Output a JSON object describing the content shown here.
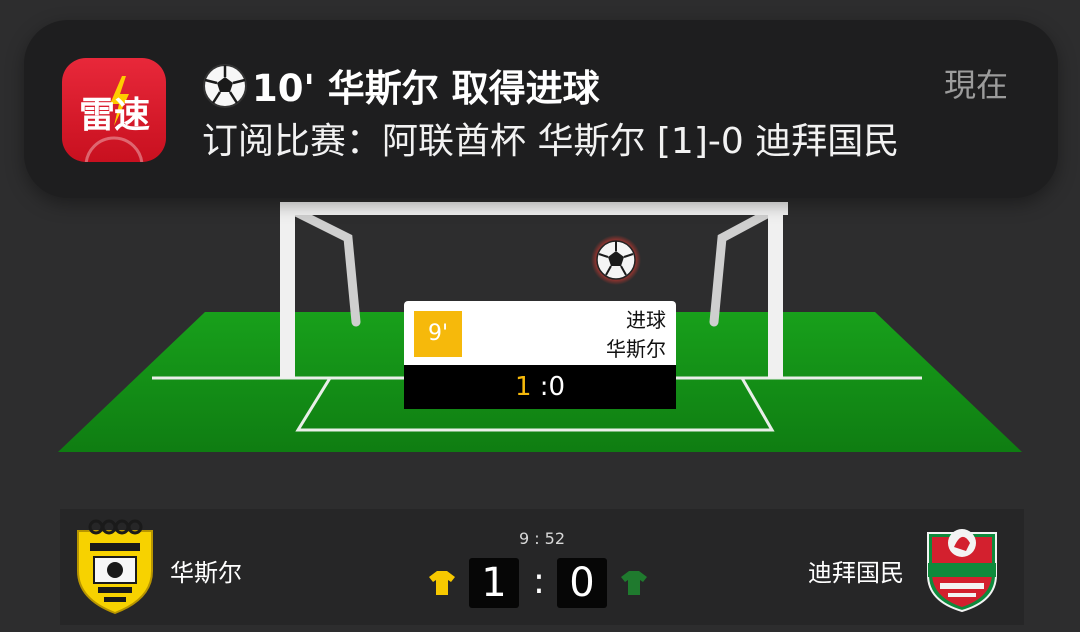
{
  "notification": {
    "app_name": "雷速",
    "title": "10' 华斯尔 取得进球",
    "body": "订阅比赛：阿联酋杯 华斯尔 [1]-0 迪拜国民",
    "time": "現在",
    "icon": "soccer-ball-emoji"
  },
  "event": {
    "minute": "9'",
    "type": "进球",
    "team": "华斯尔",
    "score_home": "1",
    "score_sep": " :",
    "score_away": "0"
  },
  "match": {
    "clock": "9 : 52",
    "home": {
      "name": "华斯尔",
      "score": "1",
      "shirt_color": "#f6c800",
      "crest_colors": [
        "#f7d200",
        "#111111"
      ]
    },
    "away": {
      "name": "迪拜国民",
      "score": "0",
      "shirt_color": "#1f7a2e",
      "crest_colors": [
        "#d3202e",
        "#0e8a3c"
      ]
    },
    "separator": ":"
  },
  "colors": {
    "background": "#2d2d2e",
    "pitch": "#1f9d1f",
    "accent": "#f6b90b",
    "app_icon": "#e0202f"
  }
}
